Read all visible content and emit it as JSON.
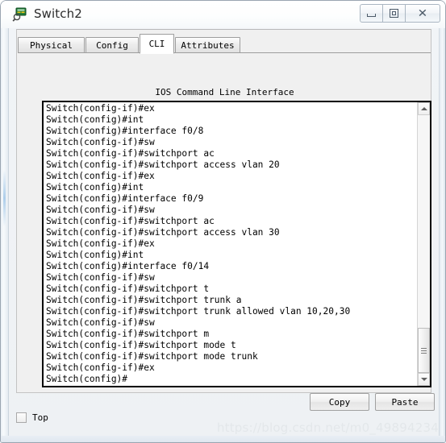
{
  "window": {
    "title": "Switch2",
    "icon": "switch-device-icon",
    "controls": {
      "minimize": "minimize-icon",
      "maximize": "restore-icon",
      "close": "close-icon"
    }
  },
  "tabs": [
    {
      "label": "Physical",
      "active": false
    },
    {
      "label": "Config",
      "active": false
    },
    {
      "label": "CLI",
      "active": true
    },
    {
      "label": "Attributes",
      "active": false
    }
  ],
  "cli": {
    "header": "IOS Command Line Interface",
    "lines": [
      "Switch(config-if)#ex",
      "Switch(config)#int",
      "Switch(config)#interface f0/8",
      "Switch(config-if)#sw",
      "Switch(config-if)#switchport ac",
      "Switch(config-if)#switchport access vlan 20",
      "Switch(config-if)#ex",
      "Switch(config)#int",
      "Switch(config)#interface f0/9",
      "Switch(config-if)#sw",
      "Switch(config-if)#switchport ac",
      "Switch(config-if)#switchport access vlan 30",
      "Switch(config-if)#ex",
      "Switch(config)#int",
      "Switch(config)#interface f0/14",
      "Switch(config-if)#sw",
      "Switch(config-if)#switchport t",
      "Switch(config-if)#switchport trunk a",
      "Switch(config-if)#switchport trunk allowed vlan 10,20,30",
      "Switch(config-if)#sw",
      "Switch(config-if)#switchport m",
      "Switch(config-if)#switchport mode t",
      "Switch(config-if)#switchport mode trunk",
      "Switch(config-if)#ex",
      "Switch(config)#"
    ],
    "scrollbar": {
      "up_arrow": "scroll-up-icon",
      "down_arrow": "scroll-down-icon",
      "thumb_position": "bottom"
    }
  },
  "buttons": {
    "copy": "Copy",
    "paste": "Paste"
  },
  "bottom": {
    "top_checkbox_label": "Top",
    "top_checkbox_checked": false
  },
  "watermark": "https://blog.csdn.net/m0_49894234",
  "colors": {
    "window_border": "#9aa5b1",
    "client_bg": "#f0f0f0",
    "terminal_border": "#000000",
    "terminal_bg": "#ffffff",
    "text": "#000000",
    "watermark": "#e3e7ea"
  }
}
